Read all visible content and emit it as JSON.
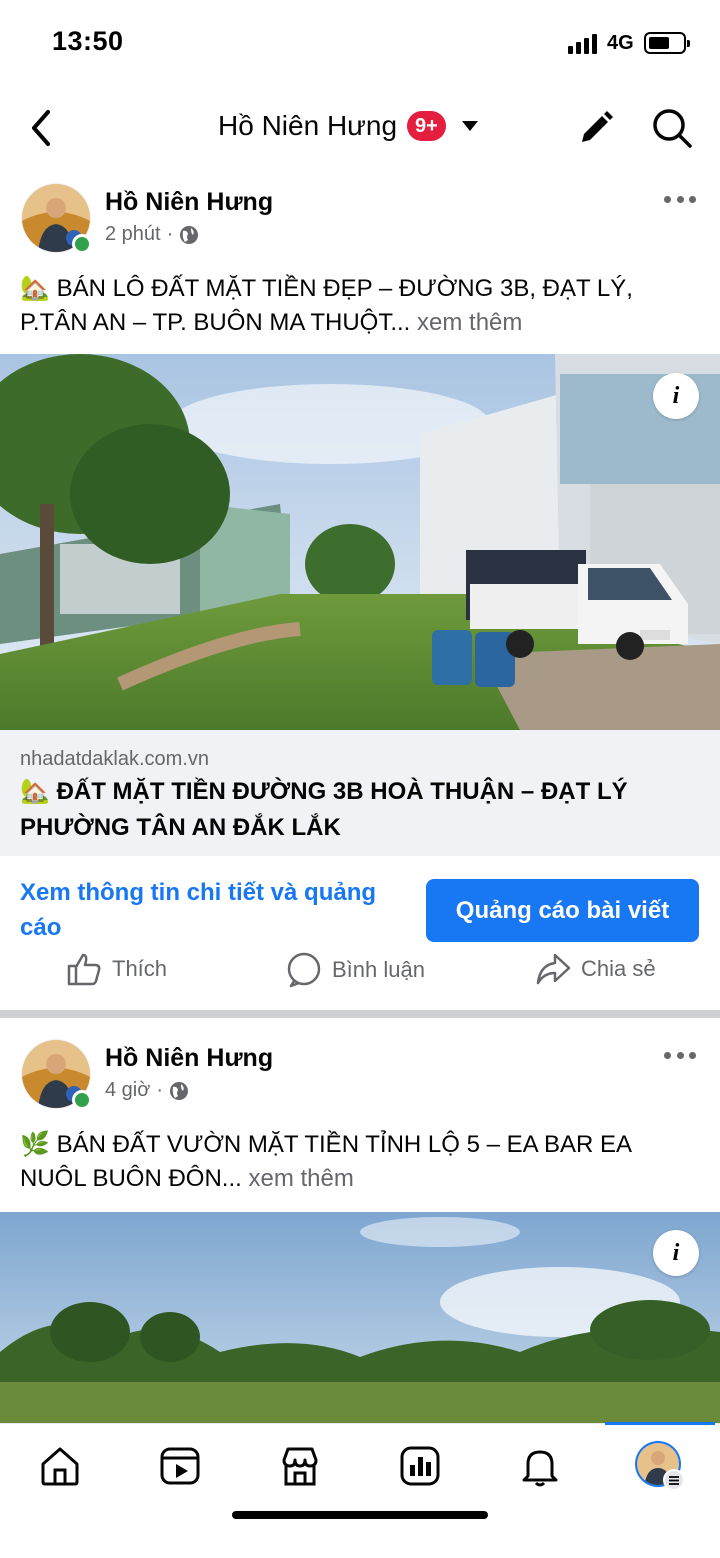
{
  "status_bar": {
    "time": "13:50",
    "network": "4G"
  },
  "header": {
    "title": "Hồ Niên Hưng",
    "badge": "9+"
  },
  "posts": [
    {
      "author": "Hồ Niên Hưng",
      "time": "2 phút",
      "emoji": "🏡",
      "text": "BÁN LÔ ĐẤT MẶT TIỀN ĐẸP – ĐƯỜNG 3B, ĐẠT LÝ, P.TÂN AN – TP. BUÔN MA THUỘT...",
      "see_more": "xem thêm",
      "link": {
        "domain": "nhadatdaklak.com.vn",
        "title": "ĐẤT MẶT TIỀN ĐƯỜNG 3B HOÀ THUẬN – ĐẠT LÝ PHƯỜNG TÂN AN ĐẮK LẮK"
      },
      "cta_text": "Xem thông tin chi tiết và quảng cáo",
      "cta_button": "Quảng cáo bài viết",
      "actions": {
        "like": "Thích",
        "comment": "Bình luận",
        "share": "Chia sẻ"
      }
    },
    {
      "author": "Hồ Niên Hưng",
      "time": "4 giờ",
      "emoji": "🌿",
      "text": "BÁN ĐẤT VƯỜN MẶT TIỀN TỈNH LỘ 5 – EA BAR EA NUÔL BUÔN ĐÔN...",
      "see_more": "xem thêm"
    }
  ],
  "info_icon_label": "i",
  "icons": {
    "back": "chevron-left-icon",
    "dropdown": "caret-down-icon",
    "edit": "pencil-icon",
    "search": "search-icon",
    "globe": "globe-icon",
    "more": "more-horizontal-icon",
    "like": "thumbs-up-icon",
    "comment": "comment-icon",
    "share": "share-icon",
    "nav": [
      "home-icon",
      "video-icon",
      "marketplace-icon",
      "dashboard-icon",
      "bell-icon",
      "profile-avatar"
    ]
  },
  "colors": {
    "brand": "#1877f2",
    "badge": "#e41e3f",
    "online": "#31a24c",
    "muted": "#65676b"
  }
}
